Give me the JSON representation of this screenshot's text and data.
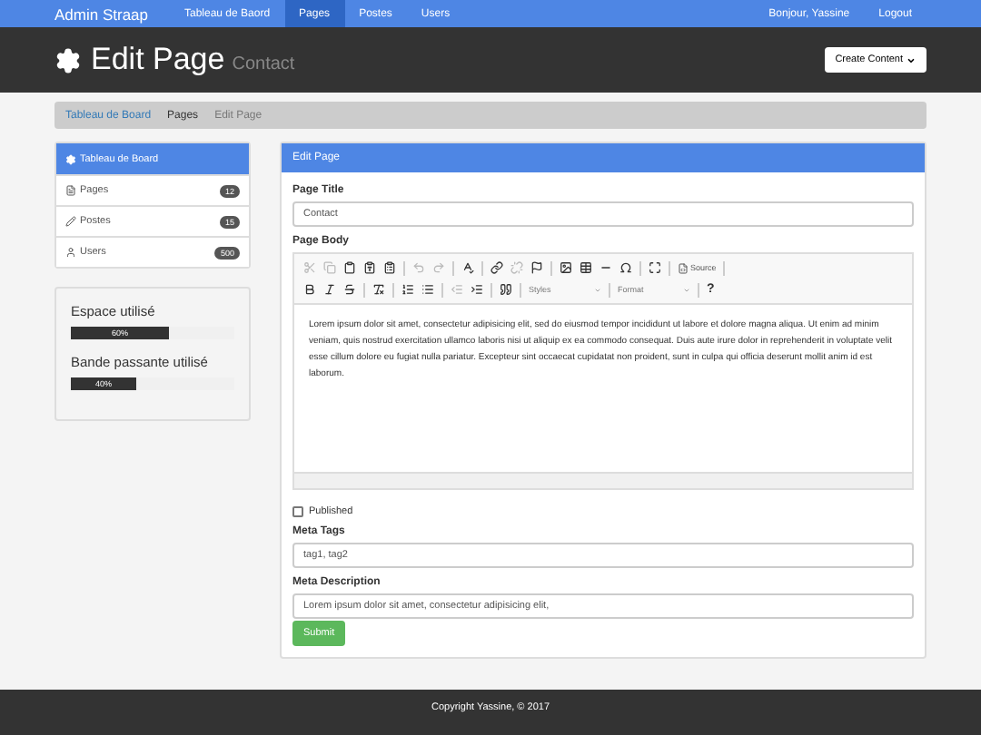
{
  "navbar": {
    "brand": "Admin Straap",
    "links": [
      {
        "label": "Tableau de Baord",
        "selected": false
      },
      {
        "label": "Pages",
        "selected": true
      },
      {
        "label": "Postes",
        "selected": false
      },
      {
        "label": "Users",
        "selected": false
      }
    ],
    "greeting": "Bonjour, Yassine",
    "logout": "Logout"
  },
  "header": {
    "title": "Edit Page",
    "subtitle": "Contact",
    "button": "Create Content"
  },
  "breadcrumb": [
    {
      "label": "Tableau de Board",
      "kind": "link"
    },
    {
      "label": "Pages",
      "kind": "plain"
    },
    {
      "label": "Edit Page",
      "kind": "current"
    }
  ],
  "sidebar": {
    "items": [
      {
        "label": "Tableau de Board",
        "selected": true,
        "kind": "dashboard"
      },
      {
        "label": "Pages",
        "selected": false,
        "count": "12",
        "kind": "pages"
      },
      {
        "label": "Postes",
        "selected": false,
        "count": "15",
        "kind": "posts"
      },
      {
        "label": "Users",
        "selected": false,
        "count": "500",
        "kind": "users"
      }
    ],
    "meters": [
      {
        "label": "Espace utilisé",
        "level": 0.6,
        "reading": "60%"
      },
      {
        "label": "Bande passante utilisé",
        "level": 0.4,
        "reading": "40%"
      }
    ]
  },
  "panel": {
    "title": "Edit Page",
    "page_title_label": "Page Title",
    "page_title": "Contact",
    "body_label": "Page Body",
    "toolbar": {
      "source": "Source",
      "styles": "Styles",
      "format": "Format",
      "help": "?"
    },
    "body": "Lorem ipsum dolor sit amet, consectetur adipisicing elit, sed do eiusmod tempor incididunt ut labore et dolore magna aliqua. Ut enim ad minim veniam, quis nostrud exercitation ullamco laboris nisi ut aliquip ex ea commodo consequat. Duis aute irure dolor in reprehenderit in voluptate velit esse cillum dolore eu fugiat nulla pariatur. Excepteur sint occaecat cupidatat non proident, sunt in culpa qui officia deserunt mollit anim id est laborum.",
    "published": {
      "label": "Published",
      "checked": false
    },
    "tags_label": "Meta Tags",
    "tags": "tag1, tag2",
    "desc_label": "Meta Description",
    "desc": "Lorem ipsum dolor sit amet, consectetur adipisicing elit,",
    "submit": "Submit"
  },
  "footer": "Copyright Yassine, © 2017"
}
